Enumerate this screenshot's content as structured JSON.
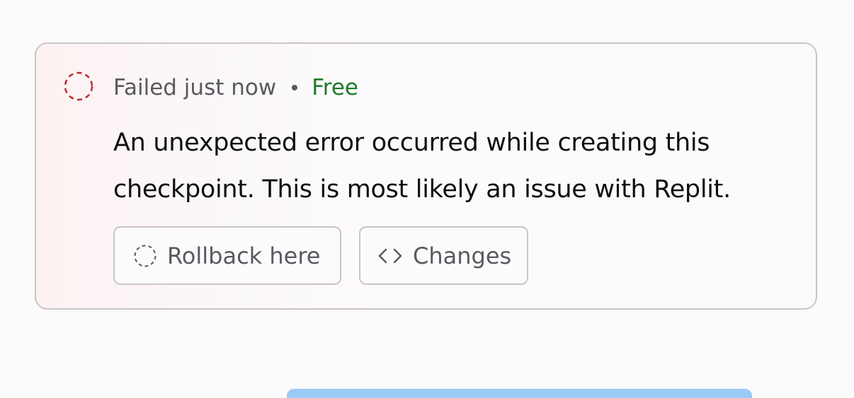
{
  "checkpoint": {
    "status_text": "Failed just now",
    "separator": "•",
    "tier": "Free",
    "message": "An unexpected error occurred while creating this checkpoint. This is most likely an issue with Replit.",
    "status_icon": "dashed-circle-icon",
    "actions": {
      "rollback_label": "Rollback here",
      "rollback_icon": "dashed-circle-icon",
      "changes_label": "Changes",
      "changes_icon": "code-brackets-icon"
    }
  },
  "colors": {
    "error": "#c0282d",
    "free": "#1e7a2a",
    "muted_text": "#5b5860",
    "border": "#cbc3c6",
    "bottom_bar": "#9ccaf6"
  }
}
